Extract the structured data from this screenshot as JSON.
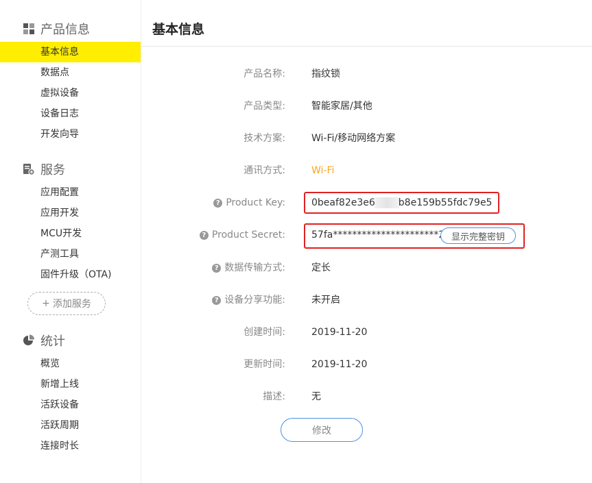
{
  "sidebar": {
    "sections": [
      {
        "title": "产品信息",
        "icon": "grid-icon",
        "items": [
          {
            "label": "基本信息",
            "active": true
          },
          {
            "label": "数据点"
          },
          {
            "label": "虚拟设备"
          },
          {
            "label": "设备日志"
          },
          {
            "label": "开发向导"
          }
        ]
      },
      {
        "title": "服务",
        "icon": "server-gear-icon",
        "items": [
          {
            "label": "应用配置"
          },
          {
            "label": "应用开发"
          },
          {
            "label": "MCU开发"
          },
          {
            "label": "产测工具"
          },
          {
            "label": "固件升级（OTA)"
          }
        ]
      },
      {
        "title": "统计",
        "icon": "pie-chart-icon",
        "items": [
          {
            "label": "概览"
          },
          {
            "label": "新增上线"
          },
          {
            "label": "活跃设备"
          },
          {
            "label": "活跃周期"
          },
          {
            "label": "连接时长"
          }
        ]
      }
    ],
    "add_service": {
      "plus": "+",
      "label": "添加服务"
    }
  },
  "main": {
    "title": "基本信息",
    "fields": {
      "product_name": {
        "label": "产品名称:",
        "value": "指纹锁"
      },
      "product_type": {
        "label": "产品类型:",
        "value": "智能家居/其他"
      },
      "tech_solution": {
        "label": "技术方案:",
        "value": "Wi-Fi/移动网络方案"
      },
      "comm_method": {
        "label": "通讯方式:",
        "value": "Wi-Fi"
      },
      "product_key": {
        "label": "Product Key:",
        "value_start": "0beaf82e3e6",
        "value_end": "b8e159b55fdc79e5"
      },
      "product_secret": {
        "label": "Product Secret:",
        "value": "57fa**********************2e40",
        "button": "显示完整密钥"
      },
      "data_transfer": {
        "label": "数据传输方式:",
        "value": "定长"
      },
      "device_share": {
        "label": "设备分享功能:",
        "value": "未开启"
      },
      "created": {
        "label": "创建时间:",
        "value": "2019-11-20"
      },
      "updated": {
        "label": "更新时间:",
        "value": "2019-11-20"
      },
      "description": {
        "label": "描述:",
        "value": "无"
      }
    },
    "edit_button": "修改",
    "help_glyph": "?"
  },
  "colors": {
    "active_highlight": "#ffee00",
    "orange_value": "#f5a623",
    "red_box": "#e02020",
    "button_border": "#4a90e2"
  }
}
